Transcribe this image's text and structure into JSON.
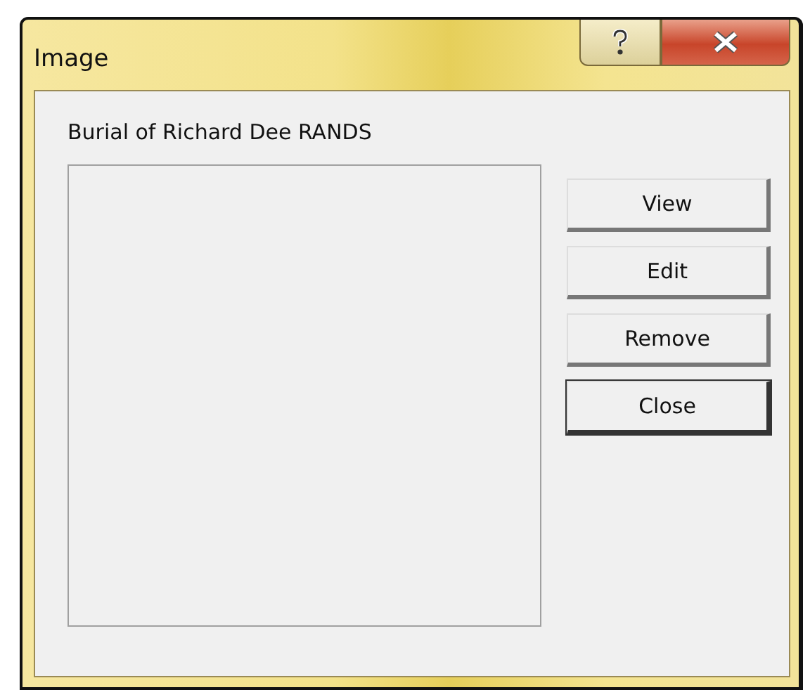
{
  "window": {
    "title": "Image"
  },
  "caption": "Burial of Richard Dee RANDS",
  "image_area": {
    "kind": "picture_frame"
  },
  "buttons": [
    {
      "label": "View",
      "default": false
    },
    {
      "label": "Edit",
      "default": false
    },
    {
      "label": "Remove",
      "default": false
    },
    {
      "label": "Close",
      "default": true
    }
  ]
}
